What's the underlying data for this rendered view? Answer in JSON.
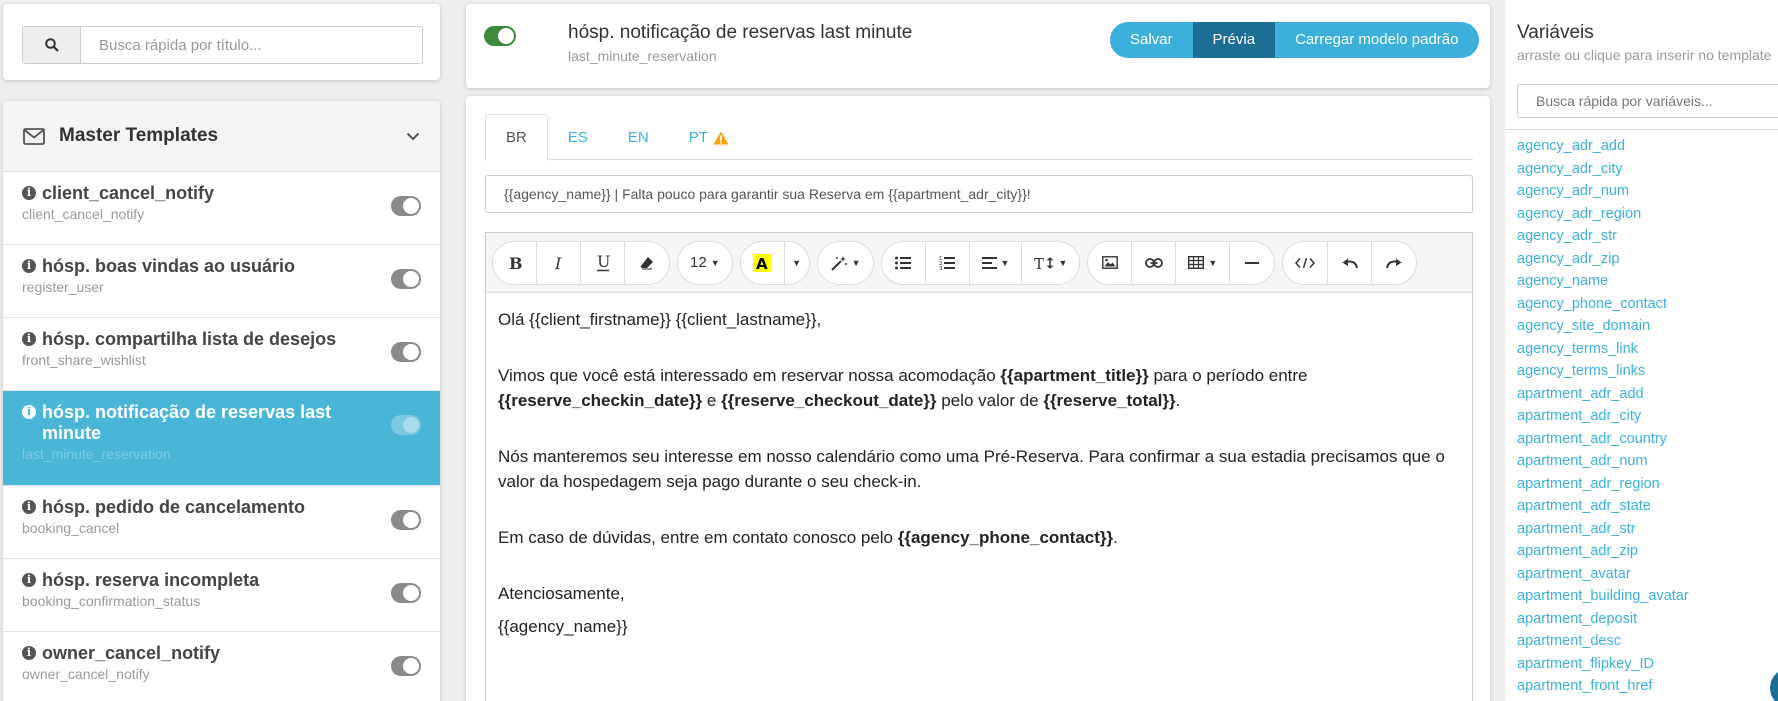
{
  "search": {
    "placeholder": "Busca rápida por título..."
  },
  "templates": {
    "title": "Master Templates",
    "items": [
      {
        "name": "client_cancel_notify",
        "code": "client_cancel_notify"
      },
      {
        "name": "hósp. boas vindas ao usuário",
        "code": "register_user"
      },
      {
        "name": "hósp. compartilha lista de desejos",
        "code": "front_share_wishlist"
      },
      {
        "name": "hósp. notificação de reservas last minute",
        "code": "last_minute_reservation"
      },
      {
        "name": "hósp. pedido de cancelamento",
        "code": "booking_cancel"
      },
      {
        "name": "hósp. reserva incompleta",
        "code": "booking_confirmation_status"
      },
      {
        "name": "owner_cancel_notify",
        "code": "owner_cancel_notify"
      }
    ]
  },
  "header": {
    "title": "hósp. notificação de reservas last minute",
    "subtitle": "last_minute_reservation",
    "save_label": "Salvar",
    "preview_label": "Prévia",
    "load_default_label": "Carregar modelo padrão"
  },
  "tabs": [
    "BR",
    "ES",
    "EN",
    "PT"
  ],
  "subject": "{{agency_name}} | Falta pouco para garantir sua Reserva em {{apartment_adr_city}}!",
  "toolbar": {
    "font_size": "12"
  },
  "body": {
    "greeting": "Olá {{client_firstname}} {{client_lastname}},",
    "p1_a": "Vimos que você está interessado em reservar nossa acomodação ",
    "p1_b": "{{apartment_title}}",
    "p1_c": " para o período entre ",
    "p1_d": "{{reserve_checkin_date}}",
    "p1_e": " e ",
    "p1_f": "{{reserve_checkout_date}}",
    "p1_g": " pelo valor de ",
    "p1_h": "{{reserve_total}}",
    "p1_i": ".",
    "p2": "Nós manteremos seu interesse em nosso calendário como uma Pré-Reserva. Para confirmar a sua estadia precisamos que o valor da hospedagem seja pago durante o seu check-in.",
    "p3_a": "Em caso de dúvidas, entre em contato conosco pelo ",
    "p3_b": "{{agency_phone_contact}}",
    "p3_c": ".",
    "closing": "Atenciosamente,",
    "signature": "{{agency_name}}"
  },
  "variables": {
    "title": "Variáveis",
    "subtitle": "arraste ou clique para inserir no template",
    "search_placeholder": "Busca rápida por variáveis...",
    "items": [
      "agency_adr_add",
      "agency_adr_city",
      "agency_adr_num",
      "agency_adr_region",
      "agency_adr_str",
      "agency_adr_zip",
      "agency_name",
      "agency_phone_contact",
      "agency_site_domain",
      "agency_terms_link",
      "agency_terms_links",
      "apartment_adr_add",
      "apartment_adr_city",
      "apartment_adr_country",
      "apartment_adr_num",
      "apartment_adr_region",
      "apartment_adr_state",
      "apartment_adr_str",
      "apartment_adr_zip",
      "apartment_avatar",
      "apartment_building_avatar",
      "apartment_deposit",
      "apartment_desc",
      "apartment_flipkey_ID",
      "apartment_front_href"
    ]
  },
  "colors": {
    "accent": "#3cb0db",
    "active_item": "#49b6d8",
    "dark_button": "#1c6e94",
    "toggle_on": "#3f8a3f",
    "warning": "#f0a30a"
  }
}
